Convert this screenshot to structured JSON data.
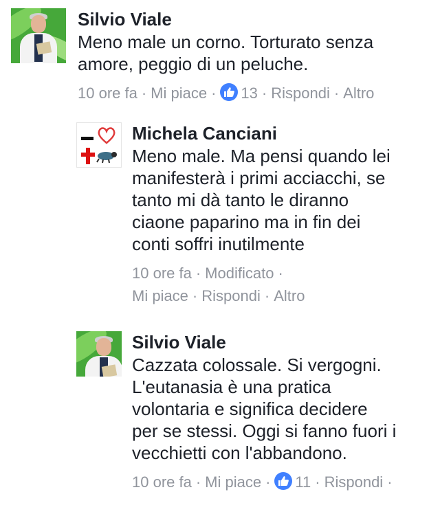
{
  "comments": [
    {
      "author": "Silvio Viale",
      "lines": [
        "Meno male un corno. Torturato senza",
        "amore, peggio di un peluche."
      ],
      "time": "10 ore fa",
      "like_label": "Mi piace",
      "likes": "13",
      "reply_label": "Rispondi",
      "more_label": "Altro",
      "avatar": "doctor-photo"
    },
    {
      "author": "Michela Canciani",
      "lines": [
        "Meno male. Ma pensi quando lei",
        "manifesterà i primi acciacchi, se",
        "tanto mi dà tanto le diranno",
        "ciaone paparino ma in fin dei",
        "conti soffri inutilmente"
      ],
      "time": "10 ore fa",
      "edited_label": "Modificato",
      "like_label": "Mi piace",
      "reply_label": "Rispondi",
      "more_label": "Altro",
      "avatar": "symbols-avatar"
    },
    {
      "author": "Silvio Viale",
      "lines": [
        "Cazzata colossale. Si vergogni.",
        "L'eutanasia è una pratica",
        "volontaria e significa decidere",
        "per se stessi. Oggi si fanno fuori i",
        "vecchietti con l'abbandono."
      ],
      "time": "10 ore fa",
      "like_label": "Mi piace",
      "likes": "11",
      "reply_label": "Rispondi",
      "avatar": "doctor-photo"
    }
  ],
  "meta_separator": "·",
  "colors": {
    "text": "#1d2129",
    "meta": "#90949c",
    "like_badge": "#4080ff"
  }
}
